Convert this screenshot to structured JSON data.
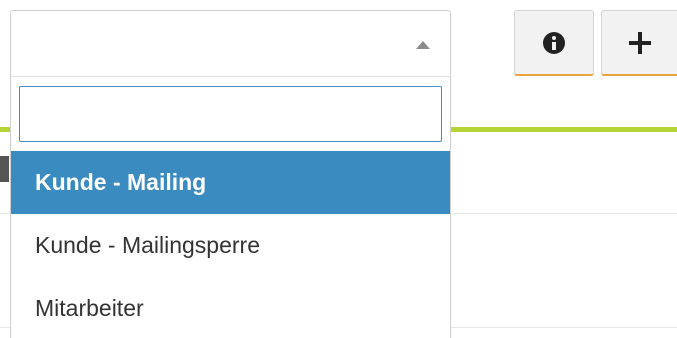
{
  "select": {
    "selected_value": ""
  },
  "dropdown": {
    "search": {
      "value": "",
      "placeholder": ""
    },
    "options": [
      {
        "label": "Kunde - Mailing",
        "highlighted": true
      },
      {
        "label": "Kunde - Mailingsperre",
        "highlighted": false
      },
      {
        "label": "Mitarbeiter",
        "highlighted": false
      }
    ]
  },
  "toolbar": {
    "info_icon": "info-circle-icon",
    "add_icon": "plus-icon"
  },
  "colors": {
    "highlight": "#3a8bbf",
    "accent_line": "#b5d334",
    "button_underline": "#e8a33a",
    "search_border": "#4a8bc2"
  }
}
